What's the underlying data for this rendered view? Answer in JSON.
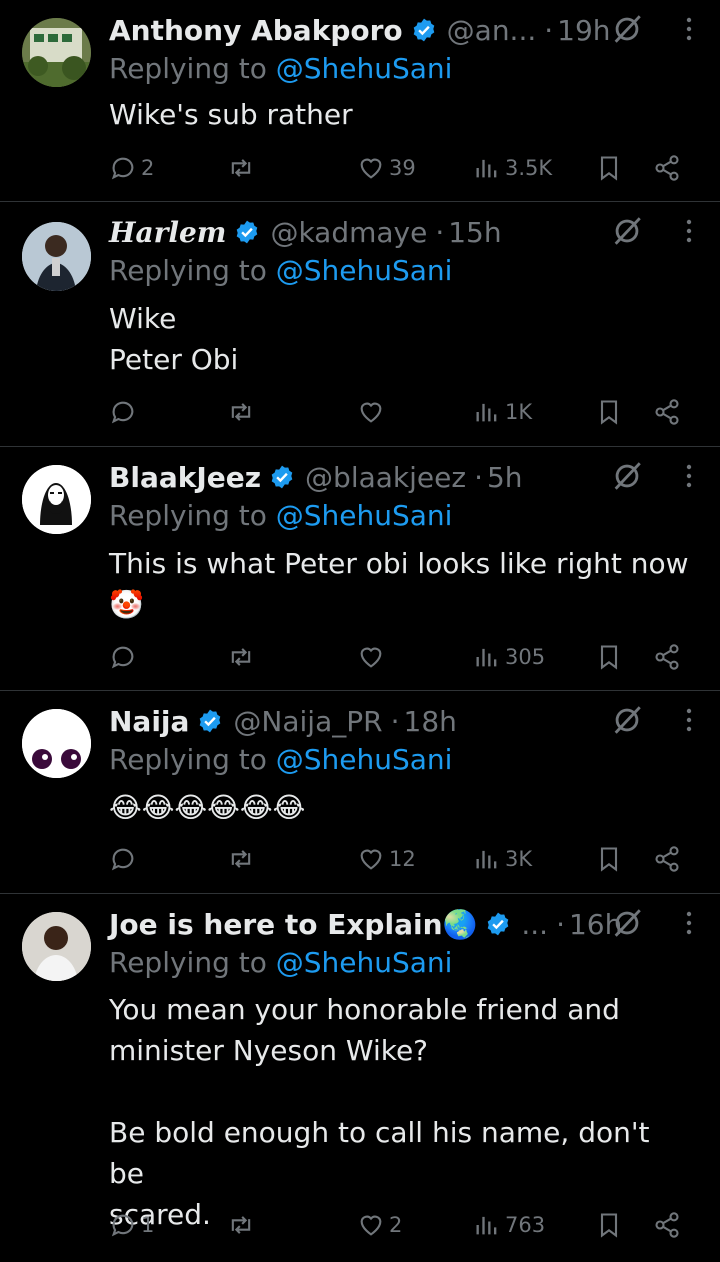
{
  "replies": [
    {
      "name": "Anthony Abakporo",
      "name_style": "bold",
      "handle": "@an...",
      "time": "19h",
      "replying_prefix": "Replying to ",
      "replying_to": "@ShehuSani",
      "body_lines": [
        "Wike's sub rather"
      ],
      "counts": {
        "replies": "2",
        "reposts": "",
        "likes": "39",
        "views": "3.5K"
      },
      "avatar": "building-photo-avatar"
    },
    {
      "name": "Harlem",
      "name_style": "script",
      "handle": "@kadmaye",
      "time": "15h",
      "replying_prefix": "Replying to ",
      "replying_to": "@ShehuSani",
      "body_lines": [
        "Wike",
        "Peter Obi"
      ],
      "counts": {
        "replies": "",
        "reposts": "",
        "likes": "",
        "views": "1K"
      },
      "avatar": "person-photo-avatar"
    },
    {
      "name": "BlaakJeez",
      "name_style": "bold",
      "handle": "@blaakjeez",
      "time": "5h",
      "replying_prefix": "Replying to ",
      "replying_to": "@ShehuSani",
      "body_lines": [
        "This is what Peter obi looks like right now",
        "🤡"
      ],
      "counts": {
        "replies": "",
        "reposts": "",
        "likes": "",
        "views": "305"
      },
      "avatar": "jesus-portrait-avatar"
    },
    {
      "name": "Naija",
      "name_style": "bold",
      "handle": "@Naija_PR",
      "time": "18h",
      "replying_prefix": "Replying to ",
      "replying_to": "@ShehuSani",
      "body_lines": [
        "😂😂😂😂😂😂"
      ],
      "counts": {
        "replies": "",
        "reposts": "",
        "likes": "12",
        "views": "3K"
      },
      "avatar": "eyes-avatar"
    },
    {
      "name": "Joe is here to Explain🌏",
      "name_style": "bold",
      "handle": "...",
      "time": "16h",
      "replying_prefix": "Replying to ",
      "replying_to": "@ShehuSani",
      "body_lines": [
        "You mean your honorable friend and",
        "minister Nyeson Wike?",
        "",
        "Be bold enough to call his name, don't be",
        "scared."
      ],
      "counts": {
        "replies": "1",
        "reposts": "",
        "likes": "2",
        "views": "763"
      },
      "avatar": "man-photo-avatar"
    }
  ],
  "colors": {
    "background": "#000000",
    "text": "#e7e9ea",
    "muted": "#71767b",
    "link": "#1d9bf0",
    "verified": "#1d9bf0",
    "divider": "#2f3336"
  }
}
